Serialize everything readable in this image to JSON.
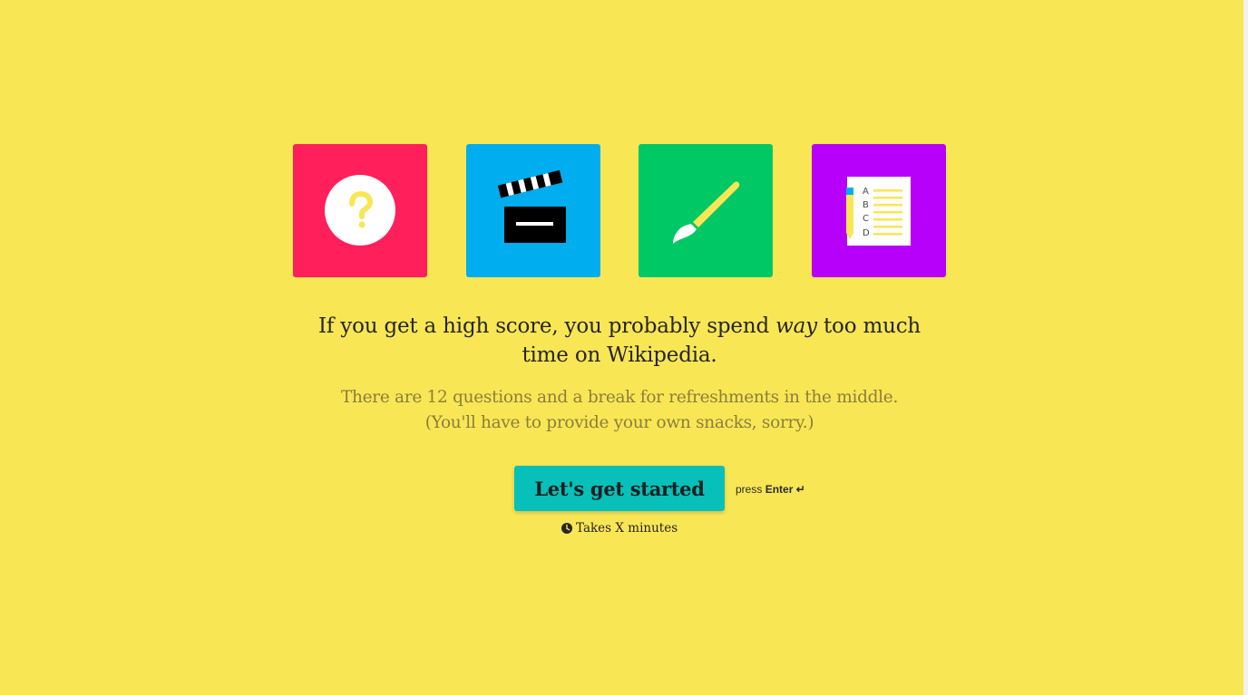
{
  "tiles": [
    {
      "name": "question-icon",
      "background": "#ff1f5a"
    },
    {
      "name": "clapperboard-icon",
      "background": "#00adef"
    },
    {
      "name": "paintbrush-icon",
      "background": "#00c864"
    },
    {
      "name": "checklist-icon",
      "background": "#b600fa"
    }
  ],
  "checklist_letters": [
    "A",
    "B",
    "C",
    "D"
  ],
  "headline": {
    "before": "If you get a high score, you probably spend ",
    "emphasis": "way",
    "after": " too much time on Wikipedia."
  },
  "subtext": {
    "line1": "There are 12 questions and a break for refreshments in the middle.",
    "line2": "(You'll have to provide your own snacks, sorry.)"
  },
  "start_button": {
    "label": "Let's get started",
    "color": "#06c0b9"
  },
  "enter_hint": {
    "prefix": "press",
    "key": "Enter ↵"
  },
  "duration": {
    "icon": "clock-icon",
    "text": "Takes X minutes"
  },
  "colors": {
    "background": "#f9e655",
    "accent_yellow": "#f9e655"
  }
}
